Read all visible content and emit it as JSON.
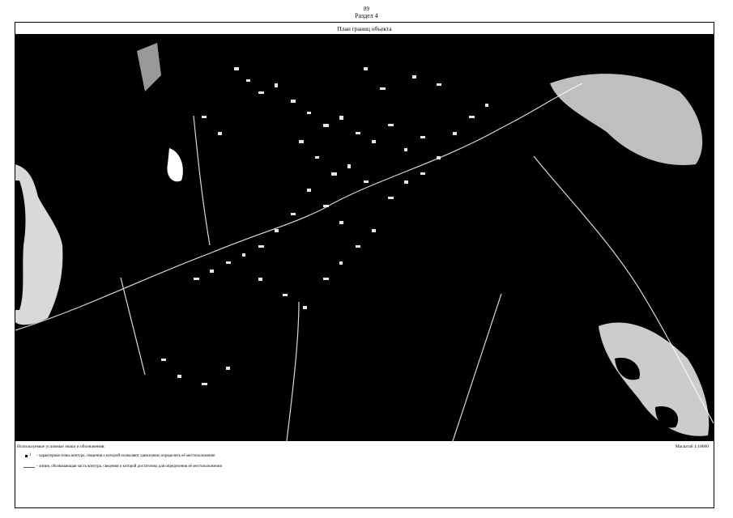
{
  "header": {
    "page_number": "89",
    "section": "Раздел 4"
  },
  "map": {
    "title": "План границ объекта",
    "background": "#000000",
    "foreground": "#ffffff",
    "imagery": "satellite-image-thresholded"
  },
  "legend": {
    "title": "Используемые условные знаки и обозначения:",
    "scale": "Масштаб 1:10000",
    "items": [
      {
        "symbol": "point-icon",
        "symbol_label": "1",
        "text": "- характерная точка контура, сведения о которой позволяют однозначно определить её местоположение"
      },
      {
        "symbol": "line-icon",
        "symbol_label": "",
        "text": "- линия, обозначающая часть контура, сведения о которой достаточны для определения её местоположения"
      }
    ]
  }
}
